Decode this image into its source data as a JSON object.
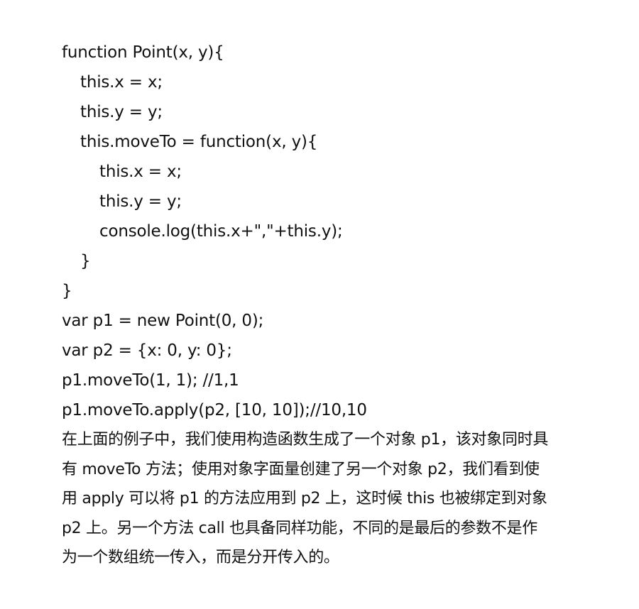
{
  "code": {
    "lines": [
      "function Point(x, y){",
      "this.x = x;",
      "this.y = y;",
      "this.moveTo = function(x, y){",
      "this.x = x;",
      "this.y = y;",
      "console.log(this.x+\",\"+this.y);",
      "}",
      "}",
      "var p1 = new Point(0, 0);",
      "var p2 = {x: 0, y: 0};",
      "p1.moveTo(1, 1); //1,1",
      "p1.moveTo.apply(p2, [10, 10]);//10,10"
    ]
  },
  "paragraph": {
    "lines": [
      "在上面的例子中，我们使用构造函数生成了一个对象 p1，该对象同时具",
      "有 moveTo 方法；使用对象字面量创建了另一个对象 p2，我们看到使",
      "用 apply 可以将 p1 的方法应用到 p2 上，这时候 this 也被绑定到对象",
      "p2 上。另一个方法 call 也具备同样功能，不同的是最后的参数不是作",
      "为一个数组统一传入，而是分开传入的。"
    ]
  }
}
